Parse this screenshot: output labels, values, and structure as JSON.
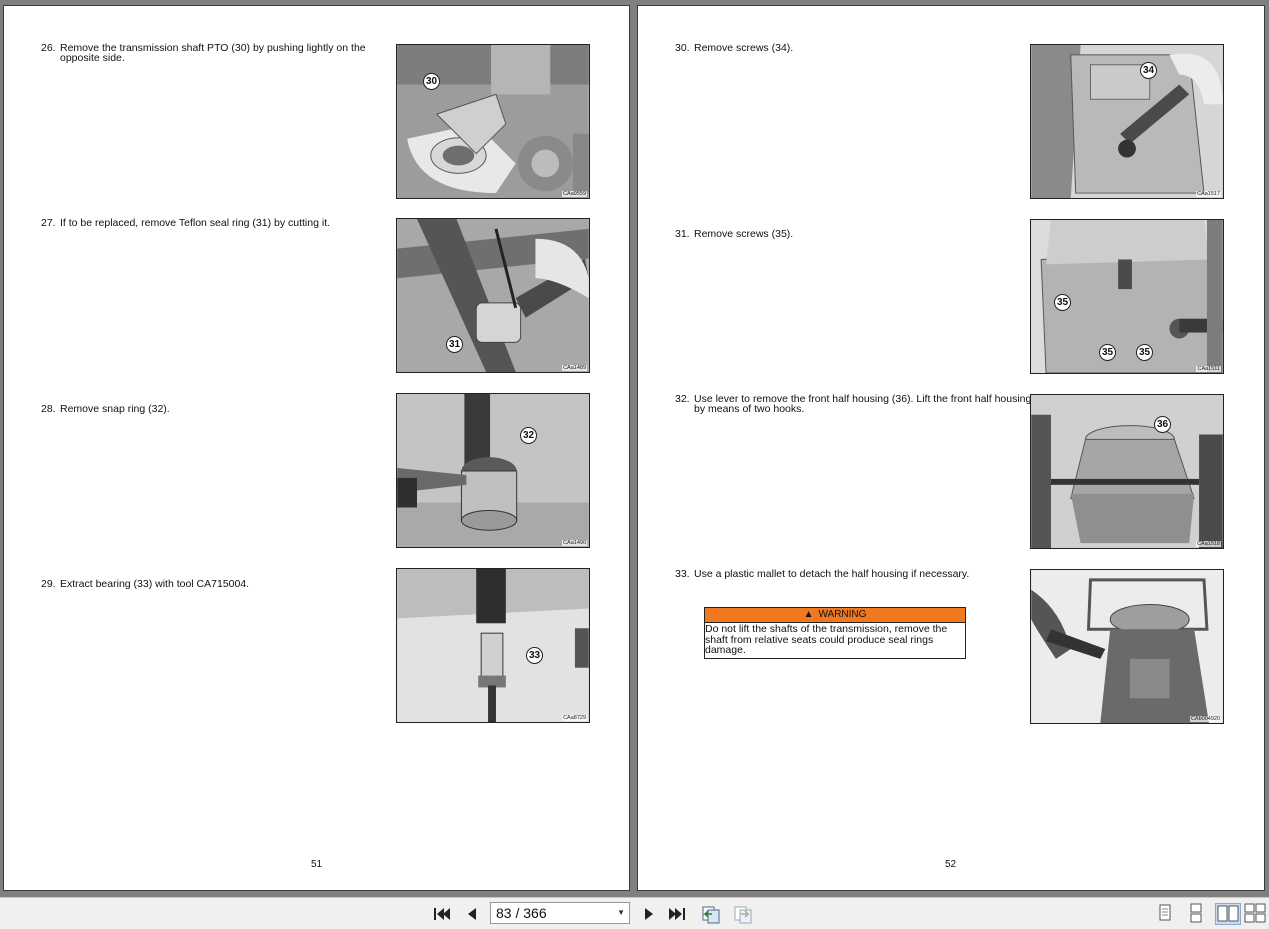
{
  "left_page": {
    "steps": [
      {
        "num": "26.",
        "text": "Remove the transmission shaft PTO (30) by pushing lightly on the opposite side.",
        "callouts": [
          "30"
        ],
        "code": "CAa9559"
      },
      {
        "num": "27.",
        "text": "If to be replaced, remove Teflon seal ring (31) by cutting it.",
        "callouts": [
          "31"
        ],
        "code": "CAa1489"
      },
      {
        "num": "28.",
        "text": "Remove snap ring (32).",
        "callouts": [
          "32"
        ],
        "code": "CAa1490"
      },
      {
        "num": "29.",
        "text": "Extract bearing (33) with tool CA715004.",
        "callouts": [
          "33"
        ],
        "code": "CAa8729"
      }
    ],
    "page_number": "51"
  },
  "right_page": {
    "steps": [
      {
        "num": "30.",
        "text": "Remove screws (34).",
        "callouts": [
          "34"
        ],
        "code": "CAa1517"
      },
      {
        "num": "31.",
        "text": "Remove screws (35).",
        "callouts": [
          "35",
          "35",
          "35"
        ],
        "code": "CAa1511"
      },
      {
        "num": "32.",
        "text": "Use lever to remove the front half housing (36). Lift the front half housing by means of two hooks.",
        "callouts": [
          "36"
        ],
        "code": "CAa1518"
      },
      {
        "num": "33.",
        "text": "Use a plastic mallet to detach the half housing if necessary.",
        "callouts": [],
        "code": "CAb004920"
      }
    ],
    "warning": {
      "title": "WARNING",
      "text": "Do not lift the shafts of the transmission, remove the shaft from relative seats could produce seal rings damage."
    },
    "page_number": "52"
  },
  "toolbar": {
    "page_indicator": "83 / 366",
    "icons": [
      "first-page-icon",
      "previous-page-icon",
      "next-page-icon",
      "last-page-icon",
      "previous-view-icon",
      "next-view-icon",
      "single-page-icon",
      "continuous-icon",
      "facing-pages-icon",
      "continuous-facing-icon"
    ]
  }
}
